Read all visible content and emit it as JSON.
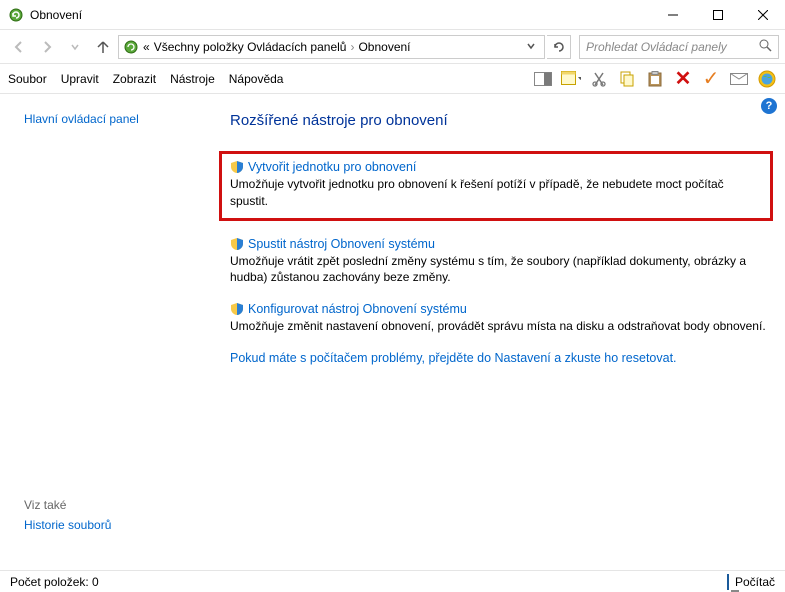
{
  "window": {
    "title": "Obnovení"
  },
  "breadcrumb": {
    "prefix": "«",
    "part1": "Všechny položky Ovládacích panelů",
    "part2": "Obnovení"
  },
  "search": {
    "placeholder": "Prohledat Ovládací panely"
  },
  "menu": {
    "soubor": "Soubor",
    "upravit": "Upravit",
    "zobrazit": "Zobrazit",
    "nastroje": "Nástroje",
    "napoved": "Nápověda"
  },
  "sidebar": {
    "main_panel": "Hlavní ovládací panel",
    "see_also": "Viz také",
    "history": "Historie souborů"
  },
  "main": {
    "heading": "Rozšířené nástroje pro obnovení",
    "item1": {
      "link": "Vytvořit jednotku pro obnovení",
      "desc": "Umožňuje vytvořit jednotku pro obnovení k řešení potíží v případě, že nebudete moct  počítač spustit."
    },
    "item2": {
      "link": "Spustit nástroj Obnovení systému",
      "desc": "Umožňuje vrátit zpět poslední změny systému s tím, že soubory (například dokumenty, obrázky a hudba) zůstanou zachovány beze změny."
    },
    "item3": {
      "link": "Konfigurovat nástroj Obnovení systému",
      "desc": "Umožňuje změnit nastavení obnovení, provádět správu místa na disku a odstraňovat body obnovení."
    },
    "reset_link": "Pokud máte s počítačem problémy, přejděte do Nastavení a zkuste ho resetovat."
  },
  "status": {
    "count": "Počet položek: 0",
    "location": "Počítač"
  }
}
